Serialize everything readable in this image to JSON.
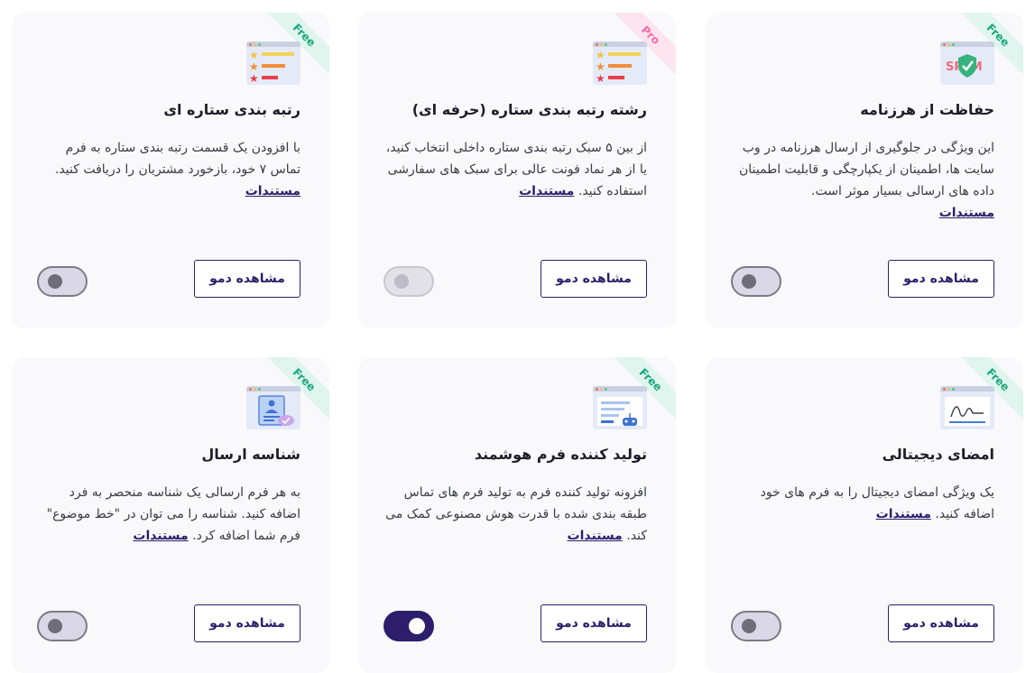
{
  "cards": [
    {
      "badge": "Free",
      "title": "حفاظت از هرزنامه",
      "description": "این ویژگی در جلوگیری از ارسال هرزنامه در وب سایت ها، اطمینان از یکپارچگی و قابلیت اطمینان داده های ارسالی بسیار موثر است.",
      "doc_link": "مستندات",
      "doc_suffix": "",
      "demo_label": "مشاهده دمو",
      "toggle_state": "off",
      "icon": "spam-shield-icon"
    },
    {
      "badge": "Pro",
      "title": "رشته رتبه بندی ستاره (حرفه ای)",
      "description": "از بین ۵ سبک رتبه بندی ستاره داخلی انتخاب کنید، یا از هر نماد فونت عالی برای سبک های سفارشی استفاده کنید.",
      "doc_link": "مستندات",
      "doc_suffix": "",
      "demo_label": "مشاهده دمو",
      "toggle_state": "disabled",
      "icon": "star-rating-icon"
    },
    {
      "badge": "Free",
      "title": "رتبه بندی ستاره ای",
      "description": "با افزودن یک قسمت رتبه بندی ستاره به فرم تماس ۷ خود، بازخورد مشتریان را دریافت کنید.",
      "doc_link": "مستندات",
      "doc_suffix": "",
      "demo_label": "مشاهده دمو",
      "toggle_state": "off",
      "icon": "star-rating-icon"
    },
    {
      "badge": "Free",
      "title": "امضای دیجیتالی",
      "description": "یک ویژگی امضای دیجیتال را به فرم های خود اضافه کنید.",
      "doc_link": "مستندات",
      "doc_suffix": "",
      "demo_label": "مشاهده دمو",
      "toggle_state": "off",
      "icon": "signature-icon"
    },
    {
      "badge": "Free",
      "title": "تولید کننده فرم هوشمند",
      "description": "افزونه تولید کننده فرم به تولید فرم های تماس طبقه بندی شده با قدرت هوش مصنوعی کمک می کند.",
      "doc_link": "مستندات",
      "doc_suffix": "",
      "demo_label": "مشاهده دمو",
      "toggle_state": "on",
      "icon": "ai-robot-icon"
    },
    {
      "badge": "Free",
      "title": "شناسه ارسال",
      "description": "به هر فرم ارسالی یک شناسه منحصر به فرد اضافه کنید. شناسه را می توان در \"خط موضوع\" فرم شما اضافه کرد.",
      "doc_link": "مستندات",
      "doc_suffix": "",
      "demo_label": "مشاهده دمو",
      "toggle_state": "off",
      "icon": "id-card-icon"
    }
  ],
  "colors": {
    "accent": "#2d1e6b",
    "free_badge": "#19a77c",
    "pro_badge": "#f06ea6",
    "card_bg": "#f9f9fb"
  }
}
